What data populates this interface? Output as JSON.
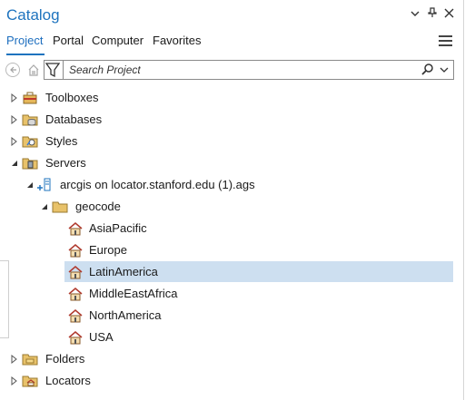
{
  "window": {
    "title": "Catalog"
  },
  "tabs": [
    {
      "label": "Project",
      "active": true
    },
    {
      "label": "Portal",
      "active": false
    },
    {
      "label": "Computer",
      "active": false
    },
    {
      "label": "Favorites",
      "active": false
    }
  ],
  "search": {
    "placeholder": "Search Project"
  },
  "tree": {
    "toolboxes": "Toolboxes",
    "databases": "Databases",
    "styles": "Styles",
    "servers": "Servers",
    "server_connection": "arcgis on locator.stanford.edu (1).ags",
    "geocode": "geocode",
    "locators_list": [
      "AsiaPacific",
      "Europe",
      "LatinAmerica",
      "MiddleEastAfrica",
      "NorthAmerica",
      "USA"
    ],
    "selected": "LatinAmerica",
    "folders": "Folders",
    "locators": "Locators"
  },
  "colors": {
    "accent": "#1e73be",
    "selection": "#cddff0"
  }
}
